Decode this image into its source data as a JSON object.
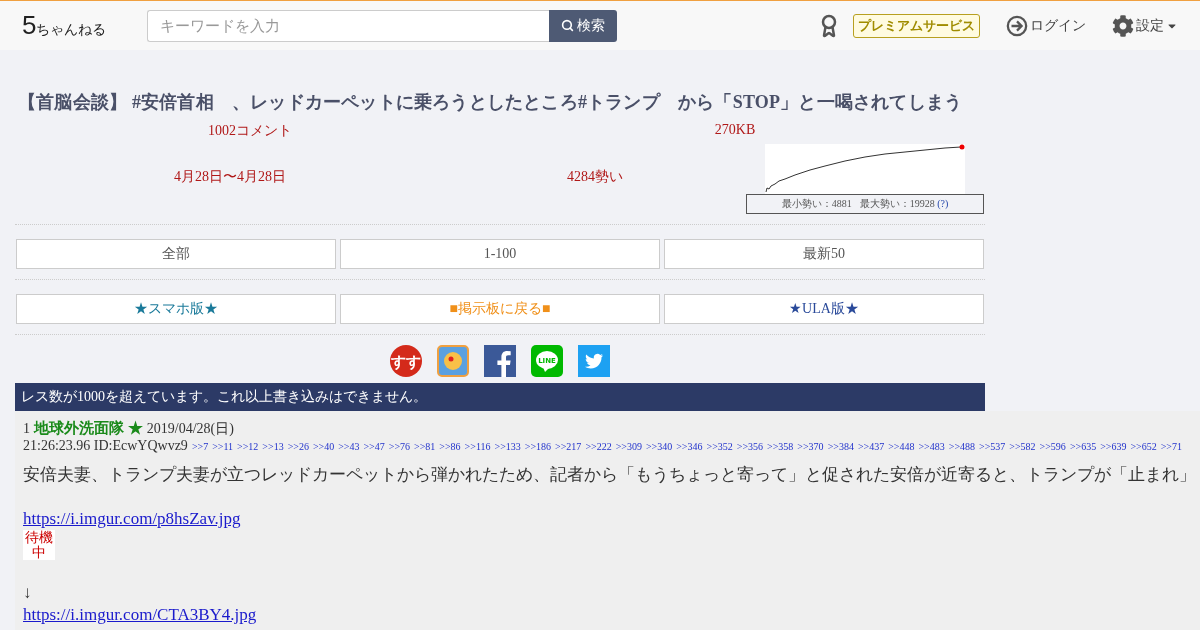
{
  "header": {
    "logo": {
      "mark": "5",
      "name": "ちゃんねる"
    },
    "search": {
      "placeholder": "キーワードを入力",
      "button": "検索"
    },
    "premium": "プレミアムサービス",
    "login": "ログイン",
    "settings": "設定"
  },
  "thread": {
    "title": "【首脳会談】 #安倍首相　、レッドカーペットに乗ろうとしたところ#トランプ　から「STOP」と一喝されてしまう",
    "comments": "1002コメント",
    "size": "270KB",
    "dates": "4月28日〜4月28日",
    "momentum": "4284勢い",
    "chart_min": "最小勢い：4881",
    "chart_max": "最大勢い：19928",
    "chart_help": "(?)"
  },
  "nav_rows": [
    [
      {
        "label": "全部",
        "color": "#555555"
      },
      {
        "label": "1-100",
        "color": "#555555"
      },
      {
        "label": "最新50",
        "color": "#555555"
      }
    ],
    [
      {
        "label": "★スマホ版★",
        "color": "#1a7a9a"
      },
      {
        "label": "■掲示板に戻る■",
        "color": "#f0901a"
      },
      {
        "label": "★ULA版★",
        "color": "#2a4a9a"
      }
    ]
  ],
  "share": [
    {
      "kind": "susu",
      "label": "すす"
    },
    {
      "kind": "app"
    },
    {
      "kind": "facebook"
    },
    {
      "kind": "line",
      "label": "LINE"
    },
    {
      "kind": "twitter"
    }
  ],
  "notice": "レス数が1000を超えています。これ以上書き込みはできません。",
  "posts": [
    {
      "number": "1",
      "name": "地球外洗面隊 ★",
      "date": "2019/04/28(日)",
      "time_id": "21:26:23.96 ID:EcwYQwvz9",
      "replies": [
        ">>7",
        ">>11",
        ">>12",
        ">>13",
        ">>26",
        ">>40",
        ">>43",
        ">>47",
        ">>76",
        ">>81",
        ">>86",
        ">>116",
        ">>133",
        ">>186",
        ">>217",
        ">>222",
        ">>309",
        ">>340",
        ">>346",
        ">>352",
        ">>356",
        ">>358",
        ">>370",
        ">>384",
        ">>437",
        ">>448",
        ">>483",
        ">>488",
        ">>537",
        ">>582",
        ">>596",
        ">>635",
        ">>639",
        ">>652",
        ">>71"
      ],
      "body": [
        {
          "kind": "text",
          "text": "安倍夫妻、トランプ夫妻が立つレッドカーペットから弾かれたため、記者から「もうちょっと寄って」と促された安倍が近寄ると、トランプが「止まれ」"
        },
        {
          "kind": "blank"
        },
        {
          "kind": "link",
          "text": "https://i.imgur.com/p8hsZav.jpg"
        },
        {
          "kind": "wait",
          "text": "待機中"
        },
        {
          "kind": "blank"
        },
        {
          "kind": "text",
          "text": "↓"
        },
        {
          "kind": "link",
          "text": "https://i.imgur.com/CTA3BY4.jpg"
        }
      ]
    }
  ]
}
